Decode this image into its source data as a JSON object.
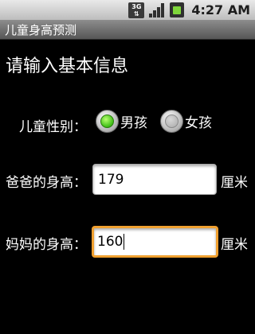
{
  "status_bar": {
    "network": "3G",
    "time": "4:27 AM"
  },
  "app_title": "儿童身高预测",
  "heading": "请输入基本信息",
  "gender": {
    "label": "儿童性别：",
    "options": [
      {
        "label": "男孩",
        "checked": true
      },
      {
        "label": "女孩",
        "checked": false
      }
    ]
  },
  "father_height": {
    "label": "爸爸的身高：",
    "value": "179",
    "unit": "厘米"
  },
  "mother_height": {
    "label": "妈妈的身高：",
    "value": "160",
    "unit": "厘米"
  },
  "colors": {
    "focus_border": "#f0a030",
    "radio_checked": "#45c21b"
  }
}
